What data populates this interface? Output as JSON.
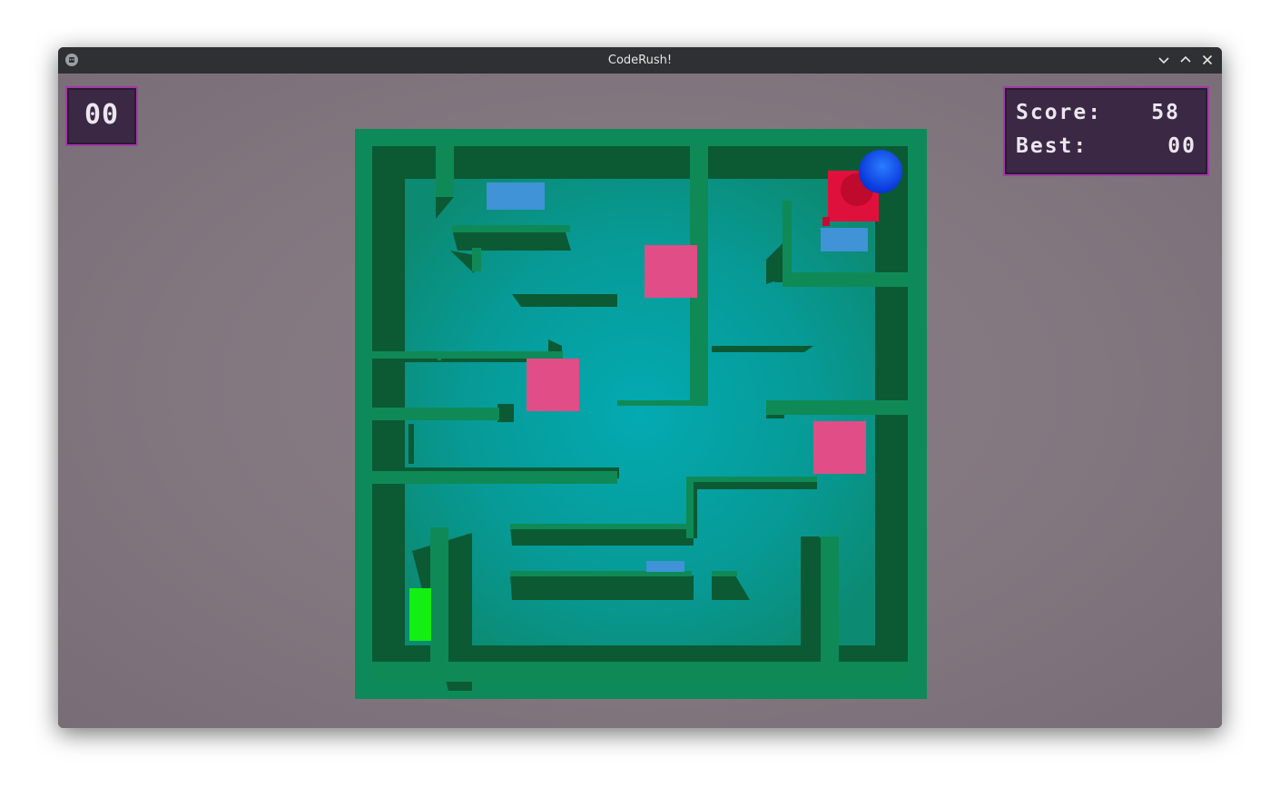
{
  "window": {
    "title": "CodeRush!",
    "app_icon": "godot-icon",
    "controls": [
      "minimize-icon",
      "maximize-icon",
      "close-icon"
    ]
  },
  "hud": {
    "timer": "00",
    "score_label": "Score:",
    "score_value": "58",
    "best_label": "Best:",
    "best_value": "00"
  },
  "colors": {
    "background": "#82767f",
    "maze_outer": "#0e8a5a",
    "maze_floor": "#06a8ac",
    "wall_top": "#0f8a57",
    "wall_shadow": "#0b5a34",
    "hud_bg": "#3a2845",
    "hud_border": "#a23aa6",
    "pink_cube": "#e04d87",
    "red_cube": "#e0103c",
    "blue_pad": "#3f93d6",
    "player_ball": "#0a4df0",
    "goal": "#13ee13"
  },
  "objects": [
    "pink-cube",
    "pink-cube",
    "pink-cube",
    "red-cube",
    "player-ball",
    "blue-pad",
    "blue-pad",
    "blue-pad",
    "green-goal"
  ]
}
